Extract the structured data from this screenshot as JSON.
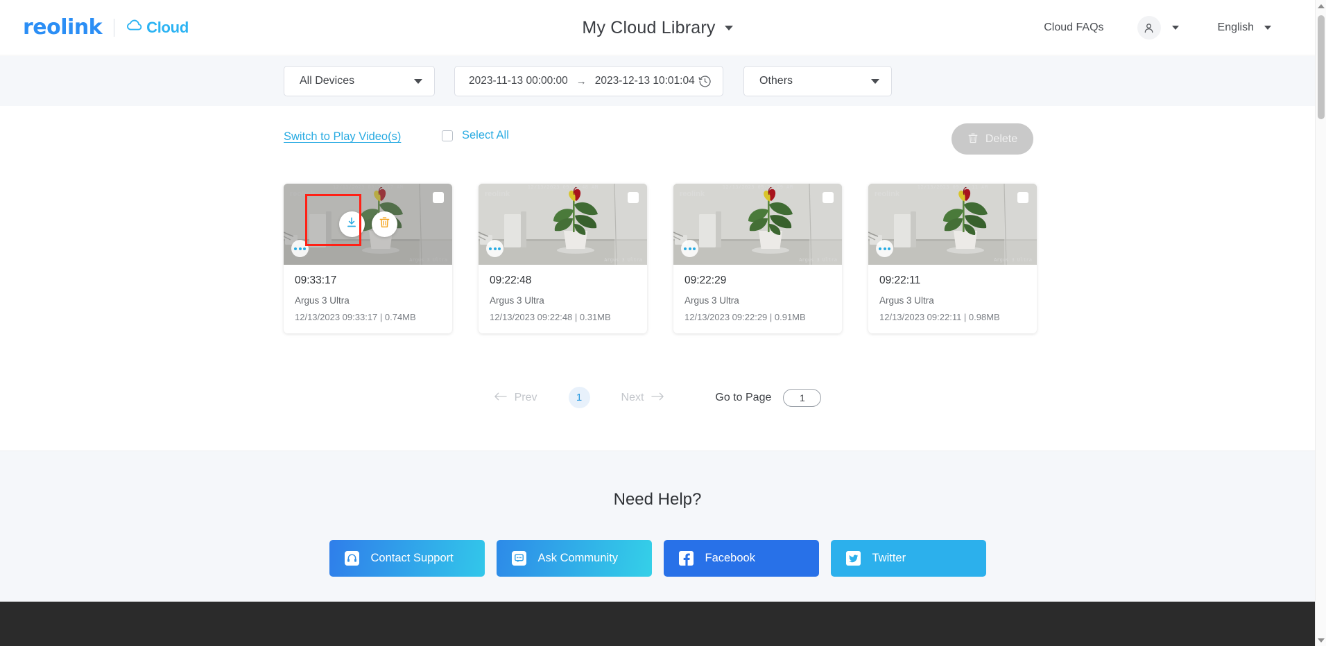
{
  "header": {
    "brand_name": "reolink",
    "cloud_label": "Cloud",
    "cloud_icon": "cloud-icon",
    "page_title": "My Cloud Library",
    "page_title_caret": "chevron-down-icon",
    "faq_label": "Cloud FAQs",
    "avatar_icon": "user-icon",
    "avatar_caret": "chevron-down-icon",
    "language": "English",
    "language_caret": "chevron-down-icon"
  },
  "filters": {
    "device_select": "All Devices",
    "device_caret": "chevron-down-icon",
    "date_start": "2023-11-13  00:00:00",
    "date_separator": "→",
    "date_end": "2023-12-13  10:01:04",
    "clock_icon": "history-clock-icon",
    "type_select": "Others",
    "type_caret": "chevron-down-icon"
  },
  "toolbar": {
    "switch_link": "Switch to Play Video(s)",
    "select_all_label": "Select All",
    "select_all_checked": false,
    "delete_label": "Delete",
    "delete_icon": "trash-icon",
    "delete_disabled": true
  },
  "cards": [
    {
      "time": "09:33:17",
      "device": "Argus 3 Ultra",
      "meta": "12/13/2023 09:33:17 | 0.74MB",
      "overlay_timestamp": "12/13/2023 09:33:17 AM",
      "watermark": "reolink",
      "device_overlay": "Argus 3 Ultra",
      "hovered": true,
      "checkbox_checked": false,
      "download_icon": "download-icon",
      "delete_icon": "trash-icon",
      "menu_icon": "more-dots-icon"
    },
    {
      "time": "09:22:48",
      "device": "Argus 3 Ultra",
      "meta": "12/13/2023 09:22:48 | 0.31MB",
      "overlay_timestamp": "12/13/2023 09:22:48 AM",
      "watermark": "reolink",
      "device_overlay": "Argus 3 Ultra",
      "hovered": false,
      "checkbox_checked": false,
      "menu_icon": "more-dots-icon"
    },
    {
      "time": "09:22:29",
      "device": "Argus 3 Ultra",
      "meta": "12/13/2023 09:22:29 | 0.91MB",
      "overlay_timestamp": "12/13/2023 09:22:29 AM",
      "watermark": "reolink",
      "device_overlay": "Argus 3 Ultra",
      "hovered": false,
      "checkbox_checked": false,
      "menu_icon": "more-dots-icon"
    },
    {
      "time": "09:22:11",
      "device": "Argus 3 Ultra",
      "meta": "12/13/2023 09:22:11 | 0.98MB",
      "overlay_timestamp": "12/13/2023 09:22:11 AM",
      "watermark": "reolink",
      "device_overlay": "Argus 3 Ultra",
      "hovered": false,
      "checkbox_checked": false,
      "menu_icon": "more-dots-icon"
    }
  ],
  "pagination": {
    "prev_label": "Prev",
    "prev_icon": "arrow-left-icon",
    "prev_disabled": true,
    "current_page": "1",
    "next_label": "Next",
    "next_icon": "arrow-right-icon",
    "next_disabled": true,
    "goto_label": "Go to Page",
    "goto_value": "1"
  },
  "help": {
    "title": "Need Help?",
    "buttons": [
      {
        "label": "Contact Support",
        "icon": "headset-icon"
      },
      {
        "label": "Ask Community",
        "icon": "chat-icon"
      },
      {
        "label": "Facebook",
        "icon": "facebook-icon"
      },
      {
        "label": "Twitter",
        "icon": "twitter-icon"
      }
    ]
  },
  "colors": {
    "brand_blue": "#2b8ef5",
    "cloud_blue": "#2bb3f3",
    "link_blue": "#29abe2",
    "annotation_red": "#ff2116",
    "delete_orange": "#f5a623",
    "footer_dark": "#2b2b2b"
  }
}
